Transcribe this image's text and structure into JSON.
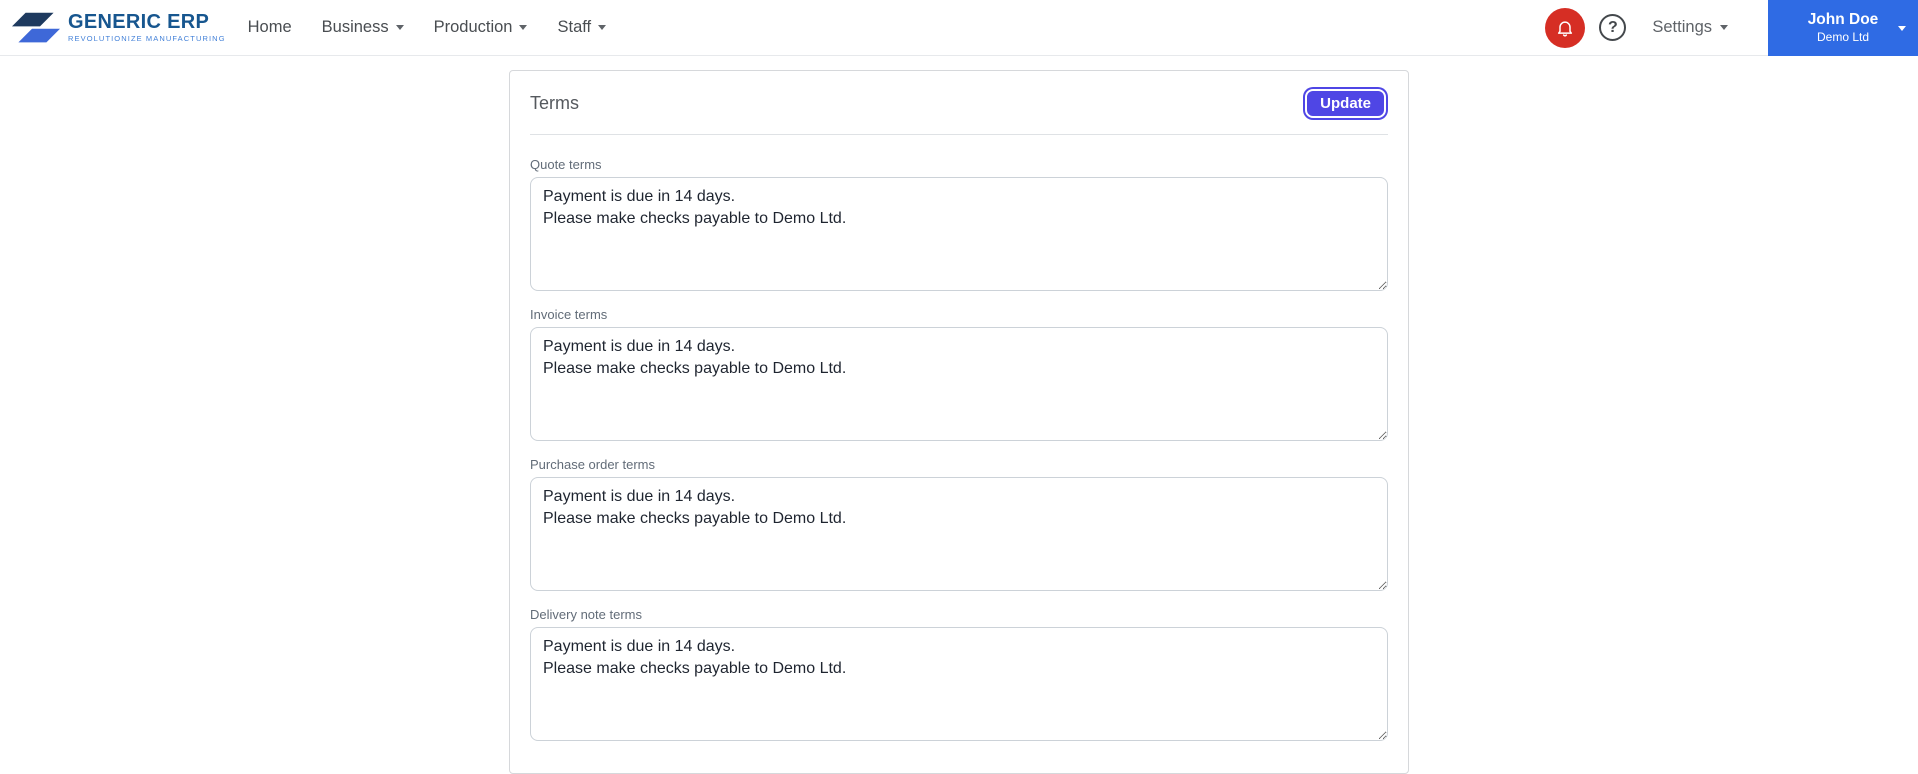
{
  "brand": {
    "name": "GENERIC ERP",
    "tagline": "REVOLUTIONIZE MANUFACTURING"
  },
  "nav": {
    "items": [
      {
        "label": "Home",
        "dropdown": false
      },
      {
        "label": "Business",
        "dropdown": true
      },
      {
        "label": "Production",
        "dropdown": true
      },
      {
        "label": "Staff",
        "dropdown": true
      }
    ]
  },
  "header_right": {
    "settings_label": "Settings",
    "help_glyph": "?",
    "user": {
      "name": "John Doe",
      "company": "Demo Ltd"
    }
  },
  "icons": {
    "notifications": "bell-icon",
    "help": "question-mark-icon",
    "dropdown": "chevron-down-icon"
  },
  "card": {
    "title": "Terms",
    "update_button": "Update",
    "fields": [
      {
        "label": "Quote terms",
        "value": "Payment is due in 14 days.\nPlease make checks payable to Demo Ltd."
      },
      {
        "label": "Invoice terms",
        "value": "Payment is due in 14 days.\nPlease make checks payable to Demo Ltd."
      },
      {
        "label": "Purchase order terms",
        "value": "Payment is due in 14 days.\nPlease make checks payable to Demo Ltd."
      },
      {
        "label": "Delivery note terms",
        "value": "Payment is due in 14 days.\nPlease make checks payable to Demo Ltd."
      }
    ]
  },
  "colors": {
    "accent_indigo": "#4f46e5",
    "user_panel_blue": "#2f6be4",
    "notification_red": "#d62e24",
    "logo_navy": "#1e3a5f",
    "logo_blue": "#3e68d8",
    "brand_text_blue": "#17568f"
  }
}
